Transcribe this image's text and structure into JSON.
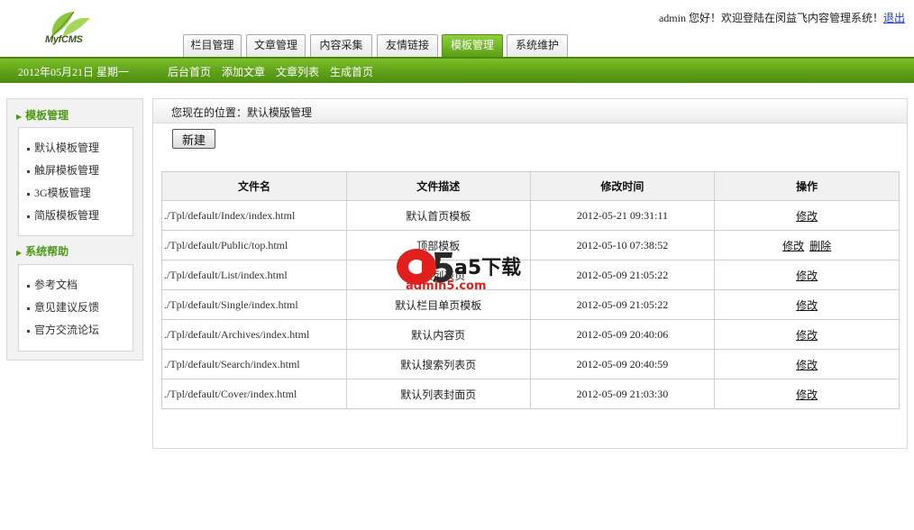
{
  "header": {
    "logo_text": "MyfCMS",
    "user": "admin",
    "welcome_text": "您好！欢迎登陆在闵益飞内容管理系统！",
    "logout_label": "退出"
  },
  "tabs": [
    {
      "label": "栏目管理",
      "active": false
    },
    {
      "label": "文章管理",
      "active": false
    },
    {
      "label": "内容采集",
      "active": false
    },
    {
      "label": "友情链接",
      "active": false
    },
    {
      "label": "模板管理",
      "active": true
    },
    {
      "label": "系统维护",
      "active": false
    }
  ],
  "bar": {
    "date": "2012年05月21日  星期一",
    "links": [
      "后台首页",
      "添加文章",
      "文章列表",
      "生成首页"
    ]
  },
  "sidebar": {
    "sections": [
      {
        "title": "模板管理",
        "items": [
          "默认模板管理",
          "触屏模板管理",
          "3G模板管理",
          "简版模板管理"
        ]
      },
      {
        "title": "系统帮助",
        "items": [
          "参考文档",
          "意见建议反馈",
          "官方交流论坛"
        ]
      }
    ]
  },
  "main": {
    "breadcrumb": "您现在的位置：默认模版管理",
    "new_button": "新建",
    "table": {
      "headers": [
        "文件名",
        "文件描述",
        "修改时间",
        "操作"
      ],
      "rows": [
        {
          "file": "./Tpl/default/Index/index.html",
          "desc": "默认首页模板",
          "time": "2012-05-21 09:31:11",
          "ops": [
            "修改"
          ]
        },
        {
          "file": "./Tpl/default/Public/top.html",
          "desc": "顶部模板",
          "time": "2012-05-10 07:38:52",
          "ops": [
            "修改",
            "删除"
          ]
        },
        {
          "file": "./Tpl/default/List/index.html",
          "desc": "默认列表页",
          "time": "2012-05-09 21:05:22",
          "ops": [
            "修改"
          ]
        },
        {
          "file": "./Tpl/default/Single/index.html",
          "desc": "默认栏目单页模板",
          "time": "2012-05-09 21:05:22",
          "ops": [
            "修改"
          ]
        },
        {
          "file": "./Tpl/default/Archives/index.html",
          "desc": "默认内容页",
          "time": "2012-05-09 20:40:06",
          "ops": [
            "修改"
          ]
        },
        {
          "file": "./Tpl/default/Search/index.html",
          "desc": "默认搜索列表页",
          "time": "2012-05-09 20:40:59",
          "ops": [
            "修改"
          ]
        },
        {
          "file": "./Tpl/default/Cover/index.html",
          "desc": "默认列表封面页",
          "time": "2012-05-09 21:03:30",
          "ops": [
            "修改"
          ]
        }
      ]
    }
  },
  "watermark": {
    "main": "a5下载",
    "sub": "admin5.com"
  },
  "colors": {
    "brand_green": "#5ea11a",
    "link_blue": "#1a3cc8",
    "watermark_red": "#e0201c"
  }
}
